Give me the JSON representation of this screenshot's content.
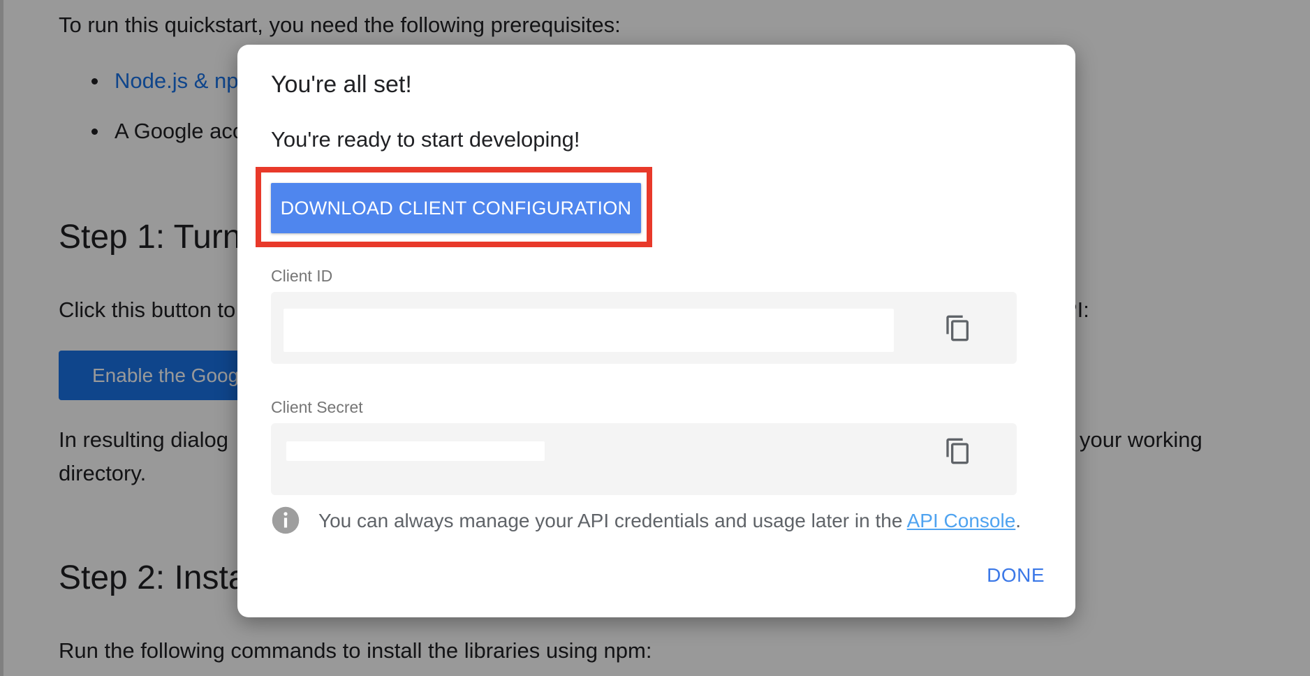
{
  "background": {
    "intro": "To run this quickstart, you need the following prerequisites:",
    "bullet1_link": "Node.js & np",
    "bullet2": "A Google acc",
    "step1_heading": "Step 1: Turn",
    "step1_text": "Click this button to",
    "step1_text_tail": "PI:",
    "enable_button": "Enable the Goog",
    "dialog_text_line1_start": "In resulting dialog",
    "dialog_text_line1_end": "your working",
    "dialog_text_line2": "directory.",
    "step2_heading": "Step 2: Insta",
    "step2_text": "Run the following commands to install the libraries using npm:"
  },
  "dialog": {
    "title": "You're all set!",
    "subtitle": "You're ready to start developing!",
    "download_button": "DOWNLOAD CLIENT CONFIGURATION",
    "client_id_label": "Client ID",
    "client_secret_label": "Client Secret",
    "info_text": "You can always manage your API credentials and usage later in the ",
    "info_link": "API Console",
    "info_suffix": ".",
    "done_button": "DONE"
  },
  "icons": {
    "copy": "copy-icon",
    "info": "info-icon"
  },
  "colors": {
    "download_button": "#4f86ee",
    "highlight_border": "#e8392a",
    "done_text": "#3b78e7",
    "link": "#4fa3f0"
  }
}
